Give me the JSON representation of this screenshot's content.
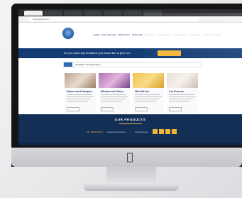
{
  "browser": {
    "address": "www.website.com"
  },
  "site": {
    "nav": [
      "HOME",
      "WHO WE ARE",
      "PRODUCTS",
      "SERVICES",
      "CONTACT",
      "OUR HISTORY",
      "COMMUNITY",
      "CAREERS",
      "LOGIN / REGISTER"
    ],
    "banner_text": "Do you have any feedback you would like to give us?",
    "search_text": "Newsletter Download Here",
    "cards": [
      {
        "title": "Values and Principles"
      },
      {
        "title": "Mission and Vision"
      },
      {
        "title": "Who We Are"
      },
      {
        "title": "Our Process"
      }
    ],
    "products": {
      "title": "OUR PRODUCTS",
      "links": [
        "ALL PRODUCTS",
        "Insurance Protection",
        "Fixed Deposit"
      ]
    }
  },
  "colors": {
    "navy": "#123b73",
    "footer": "#142f55",
    "accent": "#f0b63a"
  },
  "icons": [
    "apple-logo-icon",
    "company-logo-icon"
  ]
}
